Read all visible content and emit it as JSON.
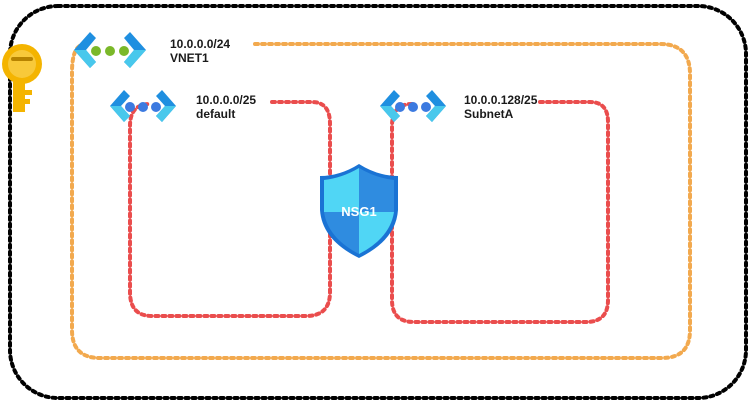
{
  "vnet": {
    "cidr": "10.0.0.0/24",
    "name": "VNET1",
    "icon": "virtual-network-icon"
  },
  "subnets": [
    {
      "cidr": "10.0.0.0/25",
      "name": "default",
      "icon": "subnet-icon"
    },
    {
      "cidr": "10.0.0.128/25",
      "name": "SubnetA",
      "icon": "subnet-icon"
    }
  ],
  "nsg": {
    "label": "NSG1",
    "icon": "network-security-group-shield-icon"
  },
  "key": {
    "icon": "key-icon"
  },
  "colors": {
    "outer_border": "#000000",
    "vnet_border": "#f2a94e",
    "subnet_border": "#ea4d4d",
    "bracket_blue": "#1f8fe0",
    "bracket_cyan": "#48c8ec",
    "vnet_dots": "#7ab829",
    "subnet_dots": "#3c7ae0",
    "key_gold": "#f4b400",
    "shield_light": "#50d6f5",
    "shield_dark": "#1a73d4"
  }
}
